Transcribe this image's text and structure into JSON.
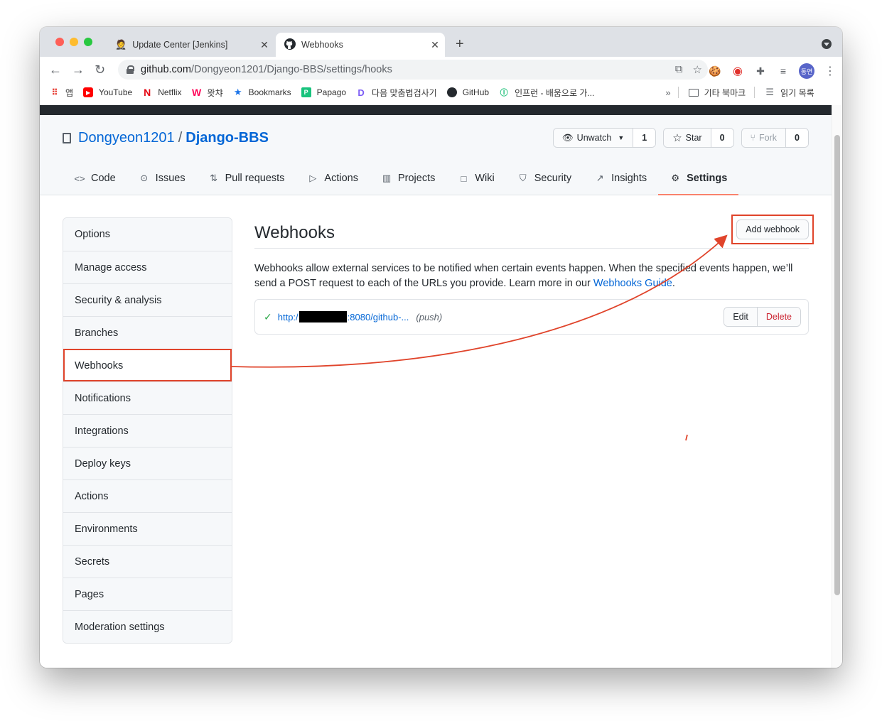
{
  "browser": {
    "tabs": [
      {
        "title": "Update Center [Jenkins]",
        "active": false
      },
      {
        "title": "Webhooks",
        "active": true
      }
    ],
    "url_host": "github.com",
    "url_path": "/Dongyeon1201/Django-BBS/settings/hooks",
    "avatar_text": "동연",
    "bookmarks": [
      {
        "label": "앱",
        "icon": "apps-grid-icon"
      },
      {
        "label": "YouTube",
        "icon": "youtube-icon"
      },
      {
        "label": "Netflix",
        "icon": "netflix-icon"
      },
      {
        "label": "왓챠",
        "icon": "watcha-icon"
      },
      {
        "label": "Bookmarks",
        "icon": "star-icon"
      },
      {
        "label": "Papago",
        "icon": "papago-icon"
      },
      {
        "label": "다음 맞춤법검사기",
        "icon": "daum-icon"
      },
      {
        "label": "GitHub",
        "icon": "github-icon"
      },
      {
        "label": "인프런 - 배움으로 가...",
        "icon": "inflearn-icon"
      }
    ],
    "bookmarks_overflow": "»",
    "other_bookmarks": "기타 북마크",
    "reading_list": "읽기 목록"
  },
  "repo": {
    "owner": "Dongyeon1201",
    "separator": "/",
    "name": "Django-BBS",
    "unwatch_label": "Unwatch",
    "unwatch_count": "1",
    "star_label": "Star",
    "star_count": "0",
    "fork_label": "Fork",
    "fork_count": "0",
    "nav": [
      {
        "label": "Code",
        "icon": "code-icon"
      },
      {
        "label": "Issues",
        "icon": "issue-icon"
      },
      {
        "label": "Pull requests",
        "icon": "pull-request-icon"
      },
      {
        "label": "Actions",
        "icon": "play-icon"
      },
      {
        "label": "Projects",
        "icon": "project-icon"
      },
      {
        "label": "Wiki",
        "icon": "book-icon"
      },
      {
        "label": "Security",
        "icon": "shield-icon"
      },
      {
        "label": "Insights",
        "icon": "graph-icon"
      },
      {
        "label": "Settings",
        "icon": "gear-icon"
      }
    ]
  },
  "sidebar": {
    "items": [
      "Options",
      "Manage access",
      "Security & analysis",
      "Branches",
      "Webhooks",
      "Notifications",
      "Integrations",
      "Deploy keys",
      "Actions",
      "Environments",
      "Secrets",
      "Pages",
      "Moderation settings"
    ],
    "active_index": 4
  },
  "main": {
    "title": "Webhooks",
    "add_button": "Add webhook",
    "description": "Webhooks allow external services to be notified when certain events happen. When the specified events happen, we’ll send a POST request to each of the URLs you provide. Learn more in our ",
    "guide_link": "Webhooks Guide",
    "description_end": ".",
    "hook": {
      "url_prefix": "http:/",
      "url_suffix": ":8080/github-...",
      "events": "(push)",
      "edit_label": "Edit",
      "delete_label": "Delete"
    }
  },
  "colors": {
    "annotation": "#e0442b",
    "link": "#0366d6",
    "selected_underline": "#f9826c"
  }
}
